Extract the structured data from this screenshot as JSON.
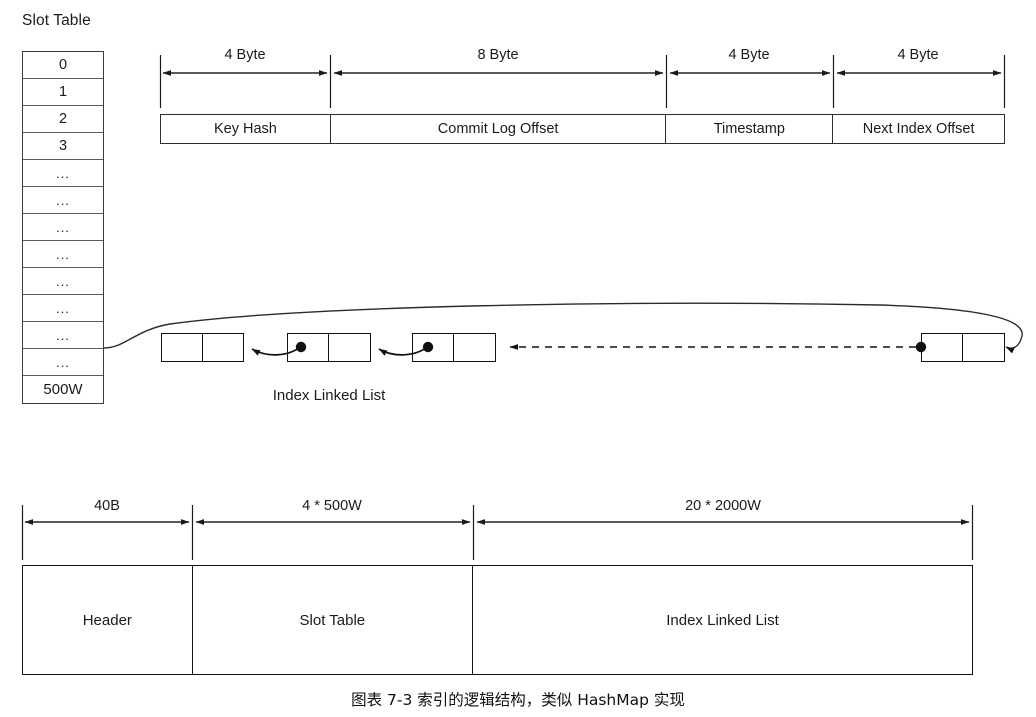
{
  "figure": {
    "caption": "图表 7-3 索引的逻辑结构，类似 HashMap 实现"
  },
  "slot_table": {
    "title": "Slot Table",
    "cells": [
      "0",
      "1",
      "2",
      "3",
      "...",
      "...",
      "...",
      "...",
      "...",
      "...",
      "...",
      "...",
      "500W"
    ]
  },
  "index_record": {
    "sizes": [
      "4 Byte",
      "8 Byte",
      "4 Byte",
      "4 Byte"
    ],
    "fields": [
      "Key Hash",
      "Commit Log Offset",
      "Timestamp",
      "Next Index Offset"
    ]
  },
  "linked_list": {
    "caption": "Index Linked List",
    "node_count": 4
  },
  "file_layout": {
    "sizes": [
      "40B",
      "4 * 500W",
      "20 * 2000W"
    ],
    "segments": [
      "Header",
      "Slot Table",
      "Index Linked List"
    ]
  },
  "colors": {
    "stroke": "#111111",
    "table_border": "#3c3c3c",
    "background": "#ffffff"
  }
}
